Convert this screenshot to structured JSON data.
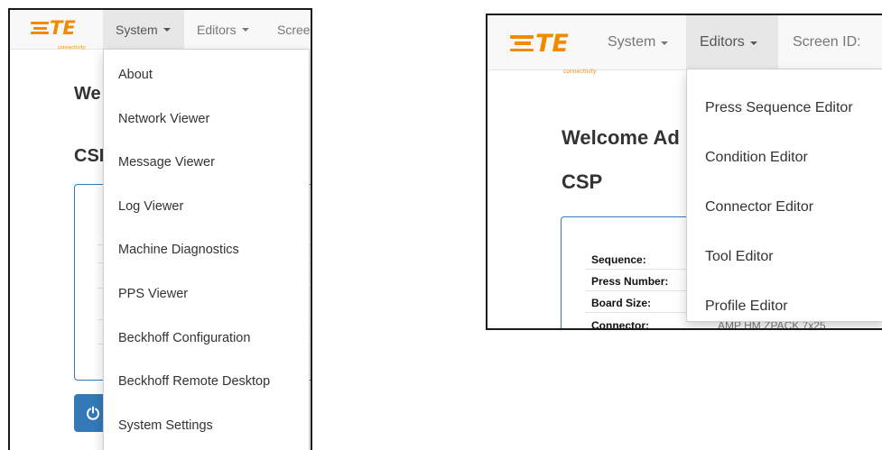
{
  "logo": {
    "text": "TE",
    "subtext": "connectivity"
  },
  "left_screenshot": {
    "nav": {
      "system": "System",
      "editors": "Editors",
      "screen": "Scree"
    },
    "welcome_partial": "We",
    "csp_partial": "CSF",
    "power_icon": "power-icon",
    "system_menu": [
      "About",
      "Network Viewer",
      "Message Viewer",
      "Log Viewer",
      "Machine Diagnostics",
      "PPS Viewer",
      "Beckhoff Configuration",
      "Beckhoff Remote Desktop",
      "System Settings"
    ]
  },
  "right_screenshot": {
    "nav": {
      "system": "System",
      "editors": "Editors",
      "screen_id": "Screen ID:"
    },
    "welcome_partial": "Welcome Ad",
    "csp": "CSP",
    "info_rows": [
      {
        "label": "Sequence:"
      },
      {
        "label": "Press Number:"
      },
      {
        "label": "Board Size:"
      },
      {
        "label": "Connector:",
        "value_partial": "AMP HM ZPACK 7x25"
      }
    ],
    "editors_menu": [
      "Press Sequence Editor",
      "Condition Editor",
      "Connector Editor",
      "Tool Editor",
      "Profile Editor"
    ]
  },
  "colors": {
    "brand_orange": "#f28a00",
    "primary_blue": "#337ab7",
    "navbar_bg": "#f8f8f8",
    "active_nav_bg": "#e7e7e7"
  }
}
